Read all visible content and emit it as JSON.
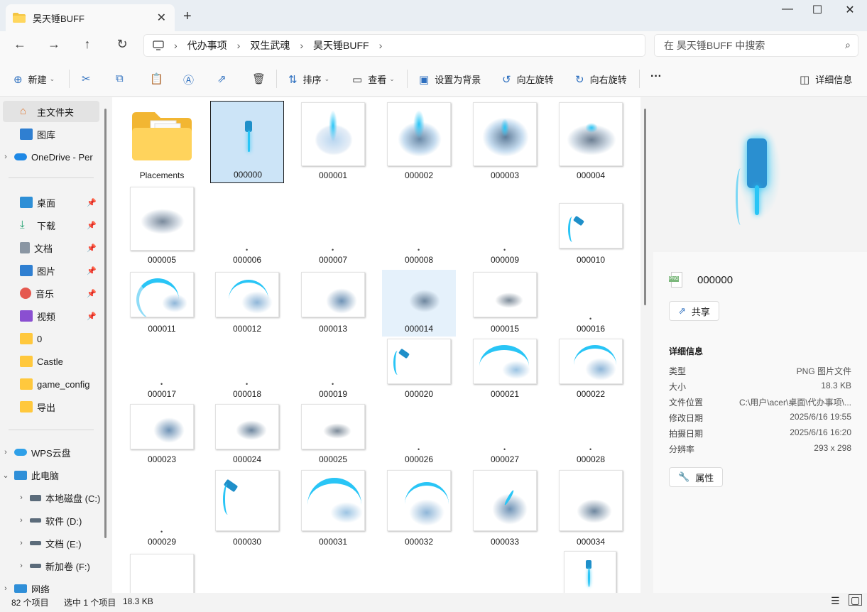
{
  "window": {
    "tab_title": "昊天锤BUFF",
    "close_tab": "✕",
    "new_tab": "+",
    "minimize": "—",
    "maximize": "☐",
    "close": "✕"
  },
  "nav": {
    "back": "←",
    "forward": "→",
    "up": "↑",
    "refresh": "↻",
    "breadcrumb": [
      "代办事项",
      "双生武魂",
      "昊天锤BUFF"
    ],
    "search_placeholder": "在 昊天锤BUFF 中搜索"
  },
  "toolbar": {
    "new_label": "新建",
    "sort_label": "排序",
    "view_label": "查看",
    "set_background": "设置为背景",
    "rotate_left": "向左旋转",
    "rotate_right": "向右旋转",
    "more": "···",
    "details": "详细信息"
  },
  "sidebar": {
    "home": "主文件夹",
    "gallery": "图库",
    "onedrive": "OneDrive - Per",
    "quick": [
      "桌面",
      "下载",
      "文档",
      "图片",
      "音乐",
      "视频",
      "0",
      "Castle",
      "game_config",
      "导出"
    ],
    "wps": "WPS云盘",
    "this_pc": "此电脑",
    "drives": [
      "本地磁盘 (C:)",
      "软件 (D:)",
      "文档 (E:)",
      "新加卷 (F:)"
    ],
    "network": "网络"
  },
  "files": {
    "folder": "Placements",
    "items": [
      "000000",
      "000001",
      "000002",
      "000003",
      "000004",
      "000005",
      "000006",
      "000007",
      "000008",
      "000009",
      "000010",
      "000011",
      "000012",
      "000013",
      "000014",
      "000015",
      "000016",
      "000017",
      "000018",
      "000019",
      "000020",
      "000021",
      "000022",
      "000023",
      "000024",
      "000025",
      "000026",
      "000027",
      "000028",
      "000029",
      "000030",
      "000031",
      "000032",
      "000033",
      "000034"
    ]
  },
  "details": {
    "file_name": "000000",
    "file_badge": "PNG",
    "share": "共享",
    "heading": "详细信息",
    "type_k": "类型",
    "type_v": "PNG 图片文件",
    "size_k": "大小",
    "size_v": "18.3 KB",
    "loc_k": "文件位置",
    "loc_v": "C:\\用户\\acer\\桌面\\代办事项\\...",
    "mod_k": "修改日期",
    "mod_v": "2025/6/16 19:55",
    "shot_k": "拍摄日期",
    "shot_v": "2025/6/16 16:20",
    "res_k": "分辨率",
    "res_v": "293 x 298",
    "properties": "属性"
  },
  "status": {
    "count": "82 个项目",
    "selected": "选中 1 个项目",
    "size": "18.3 KB"
  },
  "colors": {
    "accent": "#0067c0",
    "effect_cyan": "#29c5f6",
    "selection": "#cce4f7"
  }
}
